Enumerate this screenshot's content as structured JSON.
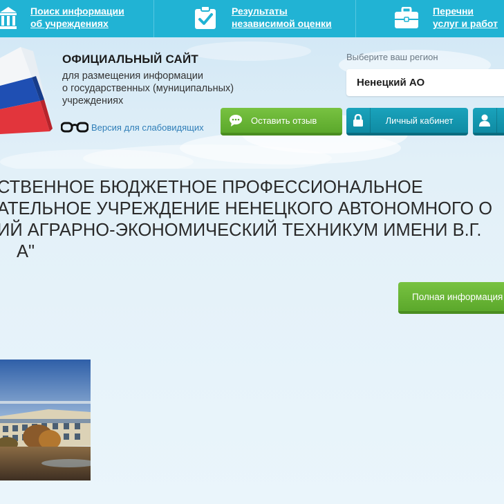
{
  "topnav": {
    "items": [
      {
        "line1": "Поиск информации",
        "line2": "об учреждениях",
        "icon": "institution-icon"
      },
      {
        "line1": "Результаты",
        "line2": "независимой оценки",
        "icon": "clipboard-check-icon"
      },
      {
        "line1": "Перечни",
        "line2": "услуг и работ",
        "icon": "briefcase-icon"
      }
    ]
  },
  "header": {
    "title": "ОФИЦИАЛЬНЫЙ САЙТ",
    "subtitle_line1": "для размещения информации",
    "subtitle_line2": "о государственных (муниципальных)",
    "subtitle_line3": "учреждениях",
    "low_vision_label": "Версия для слабовидящих"
  },
  "region": {
    "label": "Выберите ваш регион",
    "selected": "Ненецкий АО"
  },
  "actions": {
    "feedback_label": "Оставить отзыв",
    "cabinet_label": "Личный кабинет"
  },
  "organization": {
    "name_line1": "СТВЕННОЕ БЮДЖЕТНОЕ ПРОФЕССИОНАЛЬНОЕ",
    "name_line2": "АТЕЛЬНОЕ УЧРЕЖДЕНИЕ НЕНЕЦКОГО АВТОНОМНОГО О",
    "name_line3": "ИЙ АГРАРНО-ЭКОНОМИЧЕСКИЙ ТЕХНИКУМ ИМЕНИ В.Г.",
    "name_line4": "А\"",
    "full_info_label": "Полная информация"
  },
  "colors": {
    "topbar": "#21b3d4",
    "green_button": "#6ab536",
    "teal_button": "#1597ae",
    "link": "#2f7eb8"
  }
}
